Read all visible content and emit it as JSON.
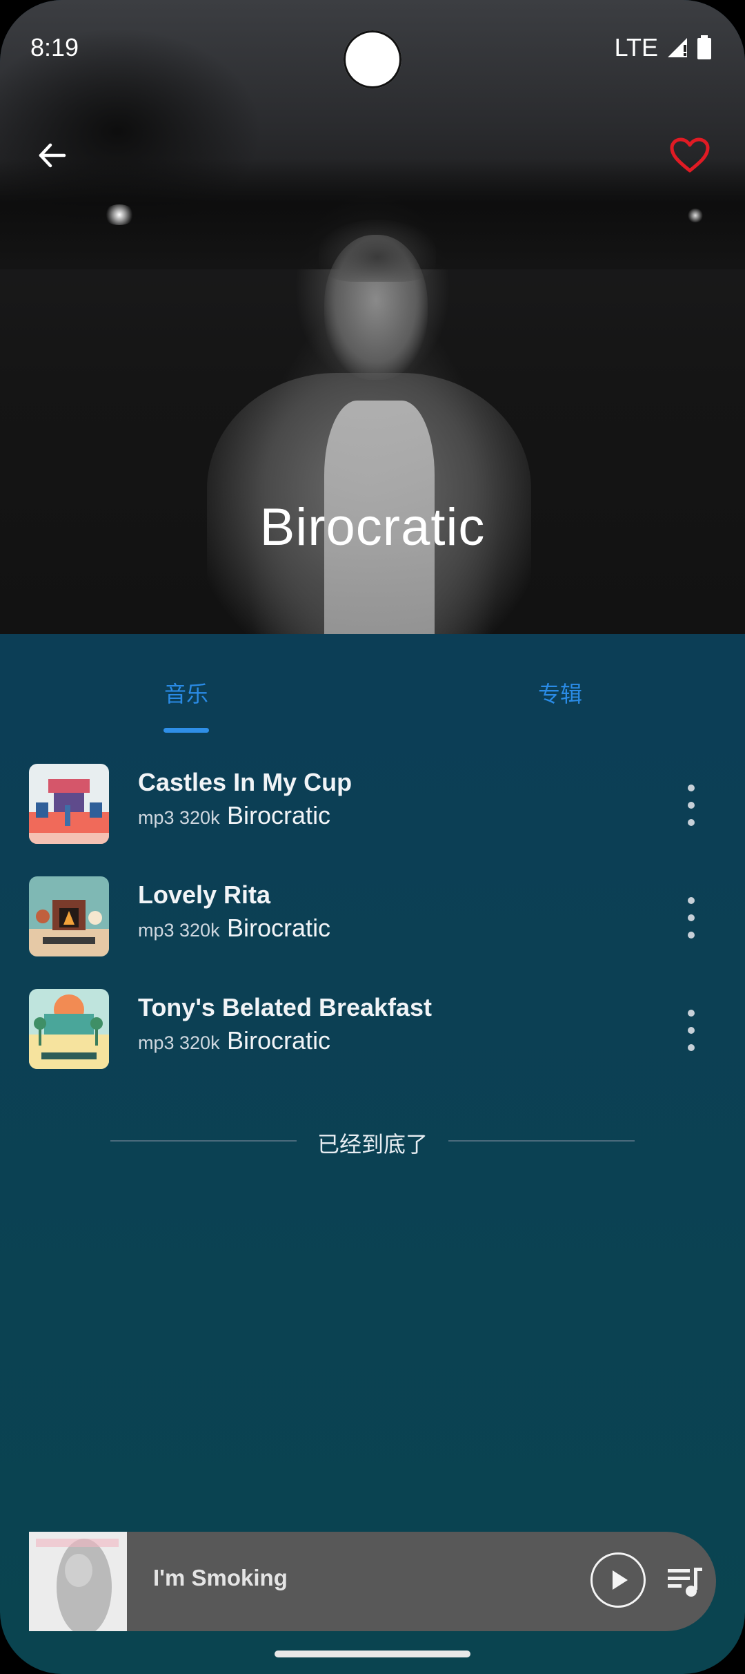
{
  "status": {
    "time": "8:19",
    "network": "LTE"
  },
  "header": {
    "artist": "Birocratic",
    "favorite_color": "#e01b24"
  },
  "tabs": [
    {
      "label": "音乐",
      "active": true
    },
    {
      "label": "专辑",
      "active": false
    }
  ],
  "songs": [
    {
      "title": "Castles In My Cup",
      "format": "mp3 320k",
      "artist": "Birocratic"
    },
    {
      "title": "Lovely Rita",
      "format": "mp3 320k",
      "artist": "Birocratic"
    },
    {
      "title": "Tony's Belated Breakfast",
      "format": "mp3 320k",
      "artist": "Birocratic"
    }
  ],
  "end_marker": "已经到底了",
  "player": {
    "title": "I'm Smoking"
  },
  "colors": {
    "accent": "#2a8be6",
    "background_top": "#0e3a5a",
    "background_bottom": "#0a4450",
    "player_bg": "#585858"
  }
}
